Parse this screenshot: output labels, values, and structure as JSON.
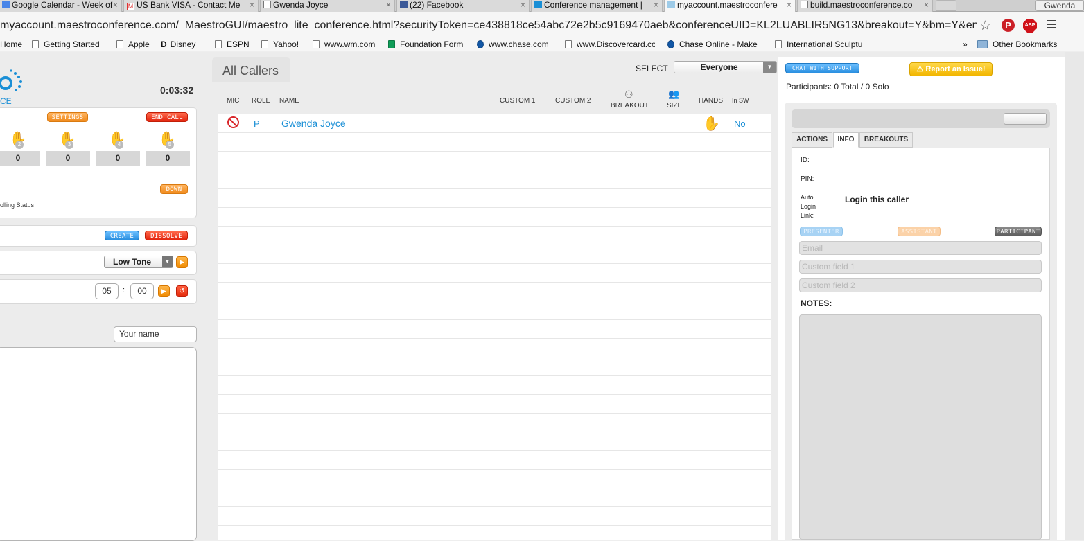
{
  "browser": {
    "tabs": [
      {
        "title": "Google Calendar - Week of",
        "icon": "calendar-icon"
      },
      {
        "title": "US Bank VISA - Contact Me",
        "icon": "gmail-icon"
      },
      {
        "title": "Gwenda Joyce",
        "icon": "page-icon"
      },
      {
        "title": "(22) Facebook",
        "icon": "facebook-icon"
      },
      {
        "title": "Conference management |",
        "icon": "maestro-icon"
      },
      {
        "title": "myaccount.maestroconfere",
        "icon": "maestro-icon"
      },
      {
        "title": "build.maestroconference.co",
        "icon": "page-icon"
      }
    ],
    "close_glyph": "×",
    "profile_name": "Gwenda",
    "url": "myaccount.maestroconference.com/_MaestroGUI/maestro_lite_conference.html?securityToken=ce438818ce54abc72e2b5c9169470aeb&conferenceUID=KL2LUABLIR5NG13&breakout=Y&bm=Y&endpoint=http:/...",
    "bookmarks": [
      "Home",
      "Getting Started",
      "Apple",
      "Disney",
      "ESPN",
      "Yahoo!",
      "www.wm.com",
      "Foundation Form",
      "www.chase.com",
      "www.Discovercard.co",
      "Chase Online - Make",
      "International Sculptu"
    ],
    "bookmarks_overflow": "»",
    "other_bookmarks": "Other Bookmarks",
    "abp_label": "ABP",
    "menu_icon": "hamburger-menu-icon"
  },
  "left": {
    "logo_text": "CE",
    "timer": "0:03:32",
    "settings_label": "SETTINGS",
    "end_call_label": "END CALL",
    "hands": [
      {
        "number": "2",
        "count": "0"
      },
      {
        "number": "3",
        "count": "0"
      },
      {
        "number": "4",
        "count": "0"
      },
      {
        "number": "5",
        "count": "0"
      }
    ],
    "down_label": "DOWN",
    "polling_status": "olling Status",
    "create_label": "CREATE",
    "dissolve_label": "DISSOLVE",
    "tone_value": "Low Tone",
    "timer_min": "05",
    "timer_sep": ":",
    "timer_sec": "00",
    "chat_name_value": "Your name"
  },
  "center": {
    "title": "All Callers",
    "select_label": "SELECT",
    "select_value": "Everyone",
    "columns": {
      "mic": "MIC",
      "role": "ROLE",
      "name": "NAME",
      "custom1": "CUSTOM 1",
      "custom2": "CUSTOM 2",
      "breakout": "BREAKOUT",
      "size": "SIZE",
      "hands": "HANDS",
      "in_sw": "In SW"
    },
    "callers": [
      {
        "role": "P",
        "name": "Gwenda Joyce",
        "in_sw": "No"
      }
    ]
  },
  "right": {
    "chat_support_label": "CHAT WITH SUPPORT",
    "report_issue_label": "Report an Issue!",
    "participants_summary": "Participants: 0 Total / 0 Solo",
    "tabs": [
      "ACTIONS",
      "INFO",
      "BREAKOUTS"
    ],
    "active_tab": "INFO",
    "id_label": "ID:",
    "pin_label": "PIN:",
    "auto_login_label_1": "Auto",
    "auto_login_label_2": "Login",
    "auto_login_label_3": "Link:",
    "login_link_text": "Login this caller",
    "presenter_label": "PRESENTER",
    "assistant_label": "ASSISTANT",
    "participant_label": "PARTICIPANT",
    "email_placeholder": "Email",
    "custom1_placeholder": "Custom field 1",
    "custom2_placeholder": "Custom field 2",
    "notes_label": "NOTES:"
  },
  "colors": {
    "link_blue": "#1a8fd6",
    "orange": "#f08a1c",
    "red": "#e3250e",
    "yellow": "#f2c21a"
  }
}
